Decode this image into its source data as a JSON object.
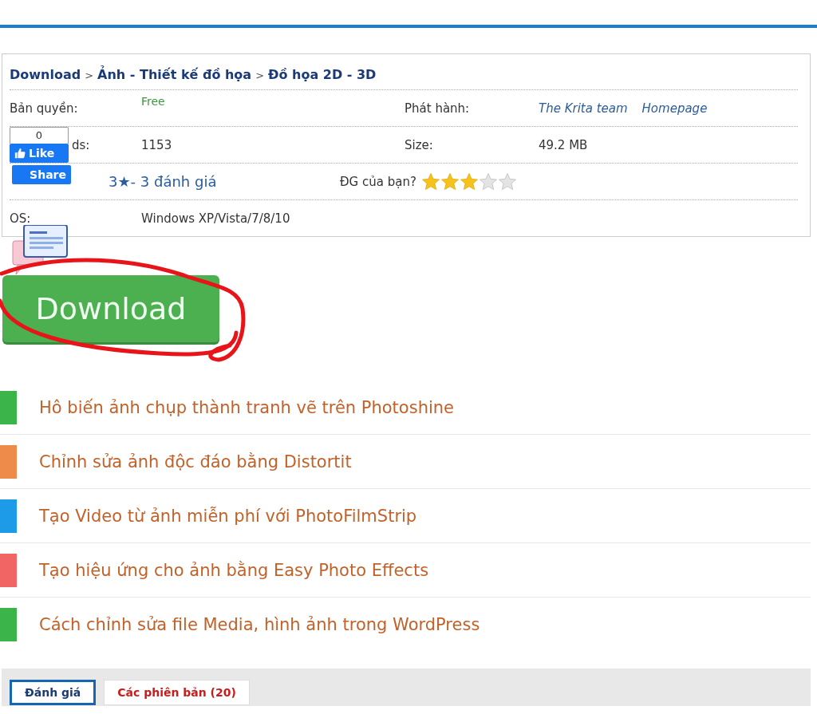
{
  "breadcrumb": [
    {
      "label": "Download",
      "separator": ">"
    },
    {
      "label": "Ảnh - Thiết kế đồ họa",
      "separator": ">"
    },
    {
      "label": "Đồ họa 2D - 3D"
    }
  ],
  "info": {
    "license_label": "Bản quyền:",
    "license": "Free",
    "publisher_label": "Phát hành:",
    "publisher": "The Krita team",
    "homepage": "Homepage",
    "downloads_label": "ds:",
    "downloads": "1153",
    "size_label": "Size:",
    "size": "49.2 MB",
    "rating": "3★- 3 đánh giá",
    "your_rating_label": "ĐG của bạn?",
    "stars": 3,
    "os_label": "OS:",
    "os": "Windows XP/Vista/7/8/10"
  },
  "social": {
    "like_count": "0",
    "like": "Like",
    "share": "Share"
  },
  "download_button": "Download",
  "related": [
    {
      "title": "Hô biến ảnh chụp thành tranh vẽ trên Photoshine",
      "color": "#3bb54a"
    },
    {
      "title": "Chỉnh sửa ảnh độc đáo bằng Distortit",
      "color": "#ee8a4a"
    },
    {
      "title": "Tạo Video từ ảnh miễn phí với PhotoFilmStrip",
      "color": "#1e9be8"
    },
    {
      "title": "Tạo hiệu ứng cho ảnh bằng Easy Photo Effects",
      "color": "#f26565"
    },
    {
      "title": "Cách chỉnh sửa file Media, hình ảnh trong WordPress",
      "color": "#3bb54a"
    }
  ],
  "tabs": [
    {
      "label": "Đánh giá",
      "selected": true
    },
    {
      "label": "Các phiên bản (20)",
      "selected": false
    }
  ]
}
